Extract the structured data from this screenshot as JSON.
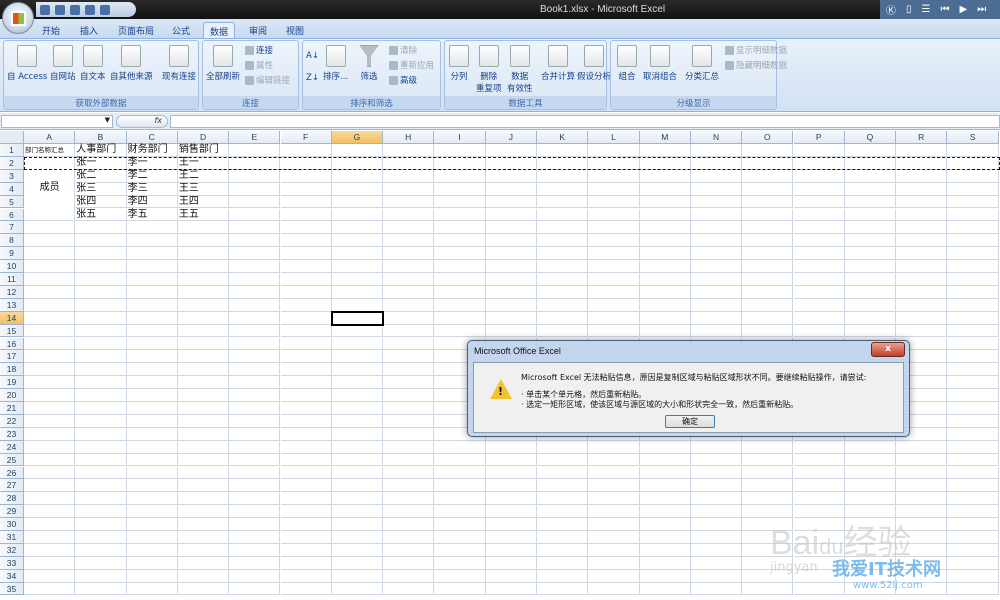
{
  "window": {
    "title": "Book1.xlsx - Microsoft Excel",
    "media_controls": [
      "K",
      "doc",
      "list",
      "prev",
      "play",
      "next"
    ]
  },
  "tabs": [
    "开始",
    "插入",
    "页面布局",
    "公式",
    "数据",
    "审阅",
    "视图"
  ],
  "active_tab": "数据",
  "ribbon": {
    "groups": [
      {
        "label": "获取外部数据",
        "buttons": [
          "自 Access",
          "自网站",
          "自文本",
          "自其他来源",
          "现有连接"
        ]
      },
      {
        "label": "连接",
        "buttons": [
          "全部刷新"
        ],
        "small": [
          "连接",
          "属性",
          "编辑链接"
        ]
      },
      {
        "label": "排序和筛选",
        "buttons": [
          "排序...",
          "筛选"
        ],
        "small": [
          "清除",
          "重新应用",
          "高级"
        ]
      },
      {
        "label": "数据工具",
        "buttons": [
          "分列",
          "删除\n重复项",
          "数据\n有效性",
          "合并计算",
          "假设分析"
        ]
      },
      {
        "label": "分级显示",
        "buttons": [
          "组合",
          "取消组合",
          "分类汇总"
        ],
        "small": [
          "显示明细数据",
          "隐藏明细数据"
        ]
      }
    ]
  },
  "formula_bar": {
    "name_box": "",
    "fx": "fx",
    "value": ""
  },
  "sheet": {
    "columns": [
      "A",
      "B",
      "C",
      "D",
      "E",
      "F",
      "G",
      "H",
      "I",
      "J",
      "K",
      "L",
      "M",
      "N",
      "O",
      "P",
      "Q",
      "R",
      "S"
    ],
    "selected_column": "G",
    "selected_row": 14,
    "rows": [
      {
        "A": "部门名称汇总",
        "B": "人事部门",
        "C": "财务部门",
        "D": "销售部门"
      },
      {
        "B": "张一",
        "C": "李一",
        "D": "王一"
      },
      {
        "B": "张二",
        "C": "李二",
        "D": "王二"
      },
      {
        "B": "张三",
        "C": "李三",
        "D": "王三"
      },
      {
        "B": "张四",
        "C": "李四",
        "D": "王四"
      },
      {
        "B": "张五",
        "C": "李五",
        "D": "王五"
      }
    ],
    "merged_A2_A6": "成员",
    "row_count": 35
  },
  "dialog": {
    "title": "Microsoft Office Excel",
    "close": "x",
    "message": "Microsoft Excel 无法粘贴信息，原因是复制区域与粘贴区域形状不同。要继续粘贴操作，请尝试:",
    "bullets": [
      "单击某个单元格，然后重新粘贴。",
      "选定一矩形区域，使该区域与源区域的大小和形状完全一致，然后重新粘贴。"
    ],
    "ok": "确定"
  },
  "watermark": {
    "baidu": "Baidu经验",
    "jingyan": "jingyan.baidu.com",
    "site": "我爱IT技术网",
    "url": "www.52ij.com"
  }
}
